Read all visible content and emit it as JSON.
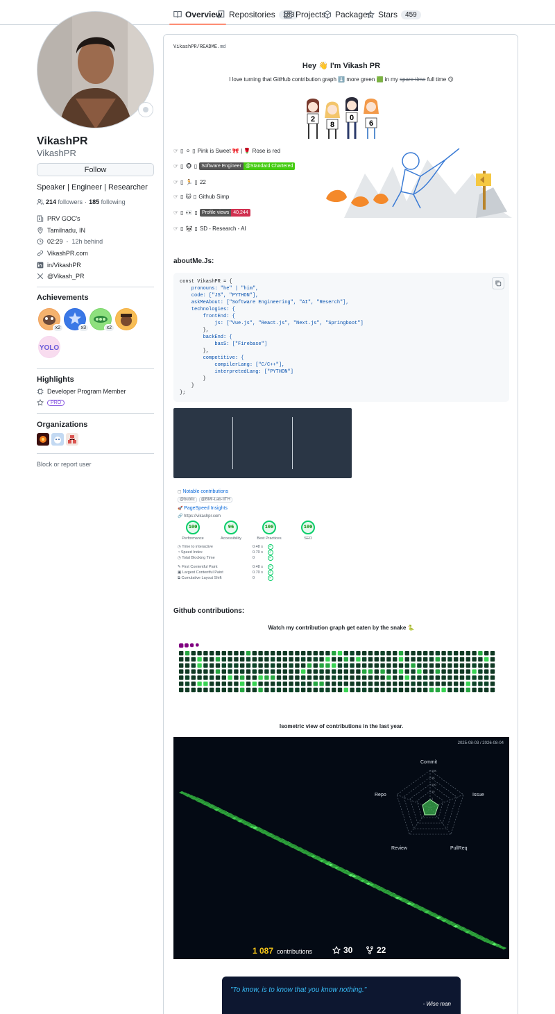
{
  "nav": {
    "tabs": [
      {
        "label": "Overview",
        "count": ""
      },
      {
        "label": "Repositories",
        "count": "183"
      },
      {
        "label": "Projects",
        "count": ""
      },
      {
        "label": "Packages",
        "count": ""
      },
      {
        "label": "Stars",
        "count": "459"
      }
    ]
  },
  "profile": {
    "name": "VikashPR",
    "login": "VikashPR",
    "follow_label": "Follow",
    "bio": "Speaker | Engineer | Researcher",
    "followers_count": "214",
    "followers_label": "followers",
    "separator": "·",
    "following_count": "185",
    "following_label": "following",
    "company": "PRV GOC's",
    "location": "Tamilnadu, IN",
    "local_time": "02:29",
    "time_sep": "-",
    "time_offset": "12h behind",
    "website": "VikashPR.com",
    "linkedin": "in/VikashPR",
    "twitter": "@Vikash_PR"
  },
  "achievements": {
    "heading": "Achievements",
    "badges": [
      {
        "icon": "pull-shark-icon",
        "count": "x2",
        "color": "#f0a05a"
      },
      {
        "icon": "starstruck-icon",
        "count": "x3",
        "color": "#2f6ce0"
      },
      {
        "icon": "pair-extraordinaire-icon",
        "count": "x2",
        "color": "#7ad66a"
      },
      {
        "icon": "quickdraw-icon",
        "count": "",
        "color": "#f5b042"
      },
      {
        "icon": "yolo-icon",
        "count": "",
        "color": "#f0c0e0"
      }
    ],
    "yolo_text": "YOLO"
  },
  "highlights": {
    "heading": "Highlights",
    "developer_program": "Developer Program Member",
    "pro_label": "PRO"
  },
  "organizations": {
    "heading": "Organizations",
    "colors": [
      "#3a0e0e",
      "#c3d9f2",
      "#f3e6e0"
    ]
  },
  "block_label": "Block or report user",
  "readme": {
    "crumb_user": "VikashPR",
    "crumb_sep": "/",
    "crumb_file": "README",
    "crumb_ext": ".md",
    "title_pre": "Hey",
    "title_post": "I'm Vikash PR",
    "intro_a": "I love turning that GitHub contribution graph",
    "intro_b": "more green",
    "intro_c": "in my",
    "intro_strike": "spare time",
    "intro_d": "full time",
    "counter_digits": [
      "2",
      "8",
      "0",
      "6"
    ],
    "facts": [
      {
        "text": "Pink is Sweet 🎀 | 🌹 Rose is red"
      },
      {
        "shield_left": "Software Engineer",
        "shield_right": "@Standard Chartered"
      },
      {
        "text": "22"
      },
      {
        "text": "Github Simp"
      },
      {
        "shield_left": "Profile views",
        "shield_right": "40,244"
      },
      {
        "text": "SD - Research - AI"
      }
    ],
    "about_heading": "aboutMe.Js:",
    "code_lines": [
      "const VikashPR = {",
      "    pronouns: \"he\" | \"him\",",
      "    code: [\"JS\", \"PYTHON\"],",
      "    askMeAbout: [\"Software Engineering\", \"AI\", \"Reserch\"],",
      "    technologies: {",
      "        frontEnd: {",
      "            js: [\"Vue.js\", \"React.js\", \"Next.js\", \"Springboot\"]",
      "        },",
      "        backEnd: {",
      "            basS: [\"Firebase\"]",
      "        },",
      "        competitive: {",
      "            compilerLang: [\"C/C++\"],",
      "            interpretedLang: [\"PYTHON\"]",
      "        }",
      "    }",
      "};"
    ],
    "notable_label": "Notable contributions",
    "notable_orgs": [
      "@bublic",
      "@BMI-Lab-IITH"
    ],
    "pagespeed_label": "PageSpeed Insights",
    "pagespeed_url": "https://vikashpr.com",
    "scores": [
      {
        "value": "100",
        "label": "Performance"
      },
      {
        "value": "96",
        "label": "Accessibility"
      },
      {
        "value": "100",
        "label": "Best Practices"
      },
      {
        "value": "100",
        "label": "SEO"
      }
    ],
    "metrics": [
      {
        "label": "Time to interactive",
        "value": "0.48 s"
      },
      {
        "label": "Speed Index",
        "value": "0.70 s"
      },
      {
        "label": "Total Blocking Time",
        "value": "0"
      },
      {
        "label": "First Contentful Paint",
        "value": "0.48 s"
      },
      {
        "label": "Largest Contentful Paint",
        "value": "0.70 s"
      },
      {
        "label": "Cumulative Layout Shift",
        "value": "0"
      }
    ],
    "contrib_heading": "Github contributions:",
    "snake_caption": "Watch my contribution graph get eaten by the snake 🐍",
    "iso_caption": "Isometric view of contributions in the last year.",
    "iso_range": "2025-08-03 / 2026-08-04",
    "radar_labels": [
      "Commit",
      "Issue",
      "PullReq",
      "Review",
      "Repo"
    ],
    "radar_ticks": [
      "10K",
      "1K",
      "100",
      "10",
      "1"
    ],
    "contrib_count": "1 087",
    "contrib_word": "contributions",
    "stars": "30",
    "forks": "22",
    "quote": "\"To know, is to know that you know nothing.\"",
    "quote_author": "- Wise man"
  },
  "colors": {
    "accent": "#fd8c73",
    "link": "#0969da",
    "contrib_green": "#39d353",
    "snake": "#800080"
  }
}
